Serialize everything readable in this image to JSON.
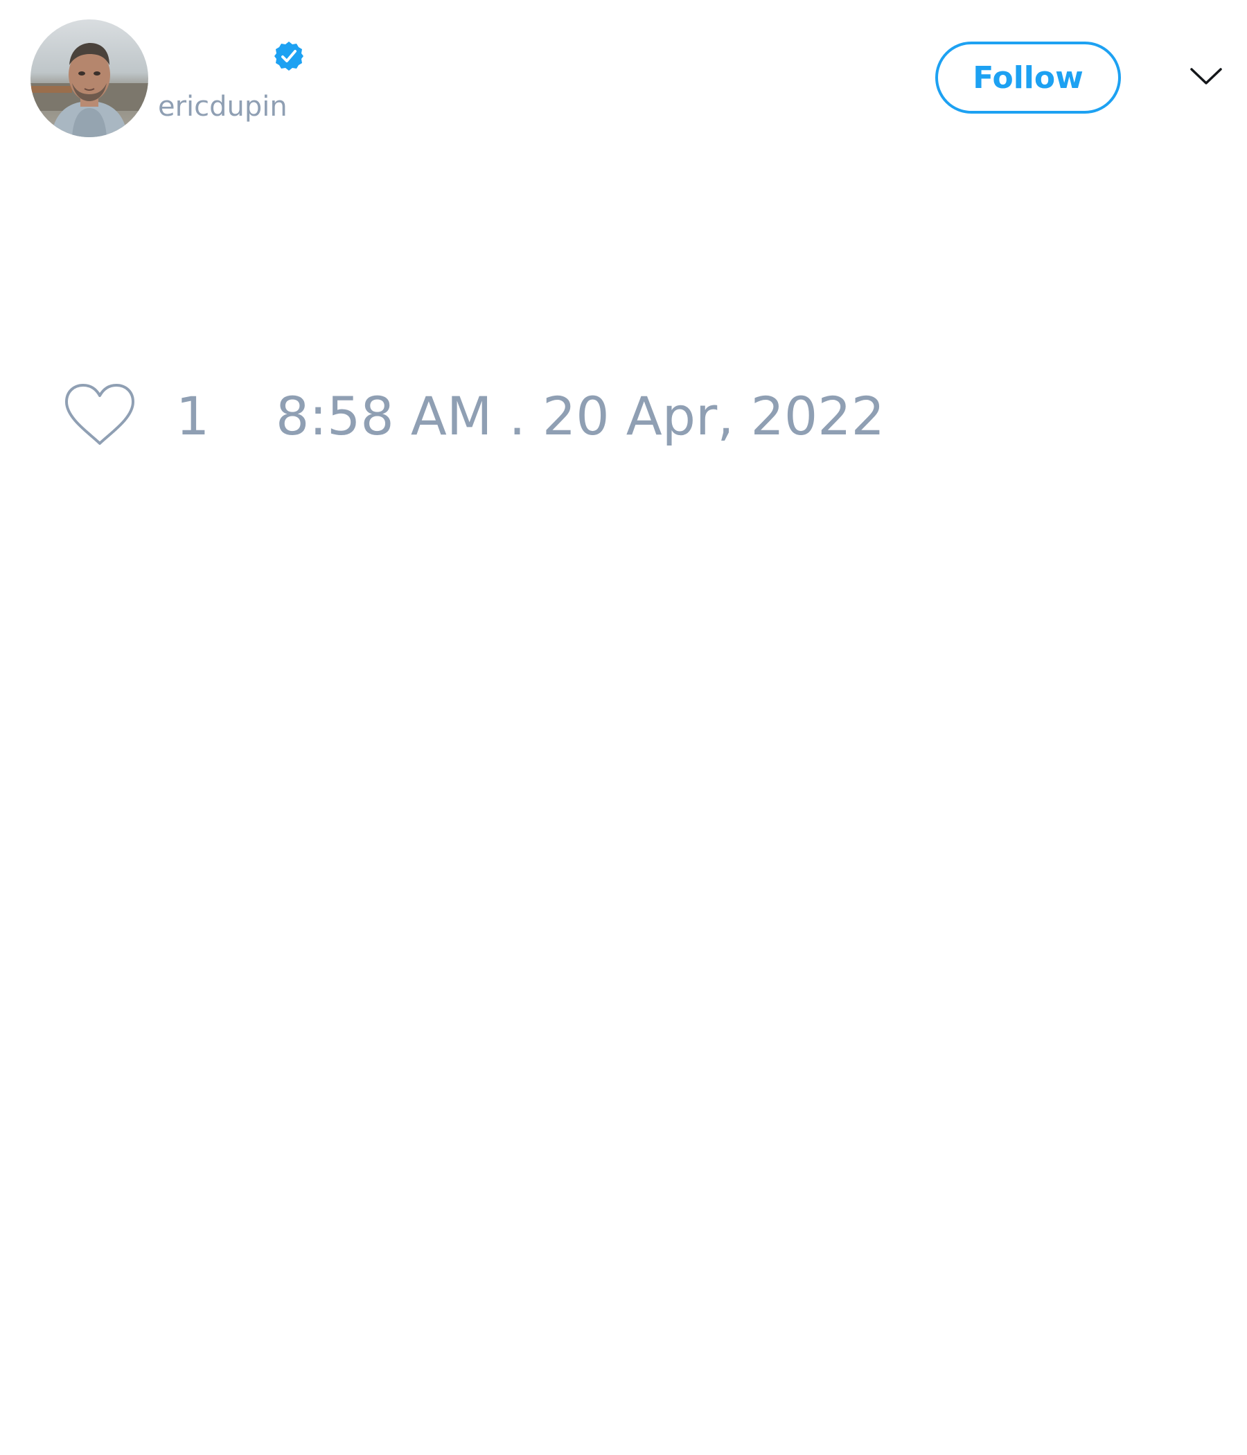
{
  "tweet": {
    "author": {
      "handle": "ericdupin",
      "verified": true,
      "avatar_icon": "avatar-photo"
    },
    "actions": {
      "follow_label": "Follow",
      "menu_icon": "chevron-down-icon"
    },
    "footer": {
      "like_icon": "heart-outline-icon",
      "like_count": "1",
      "timestamp": "8:58 AM . 20 Apr, 2022"
    }
  },
  "colors": {
    "accent": "#1da1f2",
    "muted_text": "#8f9fb3",
    "background": "#ffffff",
    "icon_dark": "#14171a"
  }
}
